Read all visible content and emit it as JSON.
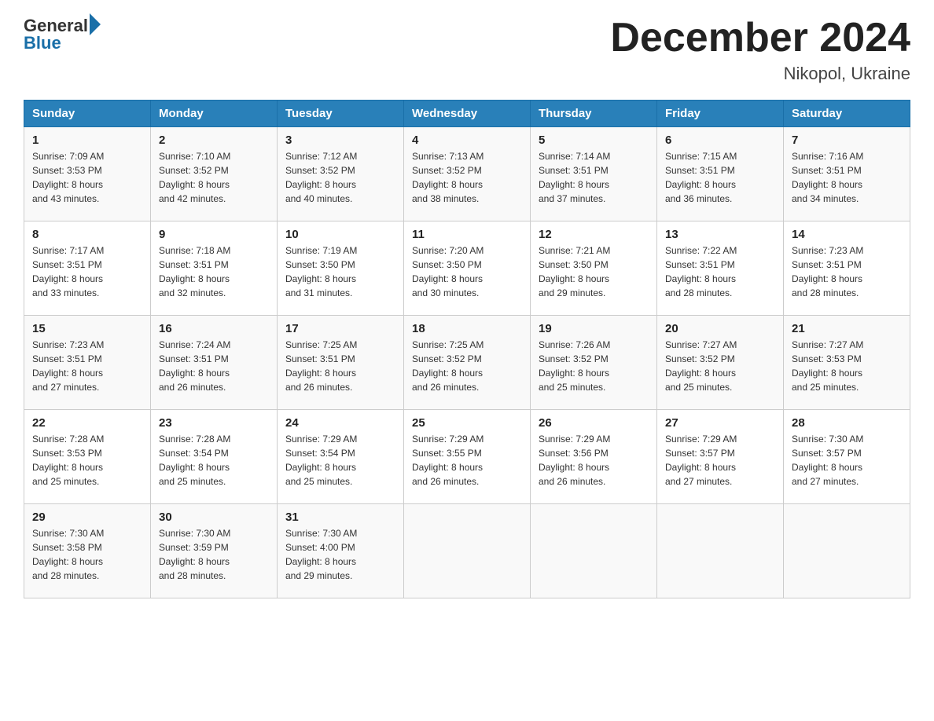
{
  "header": {
    "logo_general": "General",
    "logo_blue": "Blue",
    "month_title": "December 2024",
    "location": "Nikopol, Ukraine"
  },
  "days_of_week": [
    "Sunday",
    "Monday",
    "Tuesday",
    "Wednesday",
    "Thursday",
    "Friday",
    "Saturday"
  ],
  "weeks": [
    [
      {
        "day": "1",
        "sunrise": "7:09 AM",
        "sunset": "3:53 PM",
        "daylight": "8 hours and 43 minutes."
      },
      {
        "day": "2",
        "sunrise": "7:10 AM",
        "sunset": "3:52 PM",
        "daylight": "8 hours and 42 minutes."
      },
      {
        "day": "3",
        "sunrise": "7:12 AM",
        "sunset": "3:52 PM",
        "daylight": "8 hours and 40 minutes."
      },
      {
        "day": "4",
        "sunrise": "7:13 AM",
        "sunset": "3:52 PM",
        "daylight": "8 hours and 38 minutes."
      },
      {
        "day": "5",
        "sunrise": "7:14 AM",
        "sunset": "3:51 PM",
        "daylight": "8 hours and 37 minutes."
      },
      {
        "day": "6",
        "sunrise": "7:15 AM",
        "sunset": "3:51 PM",
        "daylight": "8 hours and 36 minutes."
      },
      {
        "day": "7",
        "sunrise": "7:16 AM",
        "sunset": "3:51 PM",
        "daylight": "8 hours and 34 minutes."
      }
    ],
    [
      {
        "day": "8",
        "sunrise": "7:17 AM",
        "sunset": "3:51 PM",
        "daylight": "8 hours and 33 minutes."
      },
      {
        "day": "9",
        "sunrise": "7:18 AM",
        "sunset": "3:51 PM",
        "daylight": "8 hours and 32 minutes."
      },
      {
        "day": "10",
        "sunrise": "7:19 AM",
        "sunset": "3:50 PM",
        "daylight": "8 hours and 31 minutes."
      },
      {
        "day": "11",
        "sunrise": "7:20 AM",
        "sunset": "3:50 PM",
        "daylight": "8 hours and 30 minutes."
      },
      {
        "day": "12",
        "sunrise": "7:21 AM",
        "sunset": "3:50 PM",
        "daylight": "8 hours and 29 minutes."
      },
      {
        "day": "13",
        "sunrise": "7:22 AM",
        "sunset": "3:51 PM",
        "daylight": "8 hours and 28 minutes."
      },
      {
        "day": "14",
        "sunrise": "7:23 AM",
        "sunset": "3:51 PM",
        "daylight": "8 hours and 28 minutes."
      }
    ],
    [
      {
        "day": "15",
        "sunrise": "7:23 AM",
        "sunset": "3:51 PM",
        "daylight": "8 hours and 27 minutes."
      },
      {
        "day": "16",
        "sunrise": "7:24 AM",
        "sunset": "3:51 PM",
        "daylight": "8 hours and 26 minutes."
      },
      {
        "day": "17",
        "sunrise": "7:25 AM",
        "sunset": "3:51 PM",
        "daylight": "8 hours and 26 minutes."
      },
      {
        "day": "18",
        "sunrise": "7:25 AM",
        "sunset": "3:52 PM",
        "daylight": "8 hours and 26 minutes."
      },
      {
        "day": "19",
        "sunrise": "7:26 AM",
        "sunset": "3:52 PM",
        "daylight": "8 hours and 25 minutes."
      },
      {
        "day": "20",
        "sunrise": "7:27 AM",
        "sunset": "3:52 PM",
        "daylight": "8 hours and 25 minutes."
      },
      {
        "day": "21",
        "sunrise": "7:27 AM",
        "sunset": "3:53 PM",
        "daylight": "8 hours and 25 minutes."
      }
    ],
    [
      {
        "day": "22",
        "sunrise": "7:28 AM",
        "sunset": "3:53 PM",
        "daylight": "8 hours and 25 minutes."
      },
      {
        "day": "23",
        "sunrise": "7:28 AM",
        "sunset": "3:54 PM",
        "daylight": "8 hours and 25 minutes."
      },
      {
        "day": "24",
        "sunrise": "7:29 AM",
        "sunset": "3:54 PM",
        "daylight": "8 hours and 25 minutes."
      },
      {
        "day": "25",
        "sunrise": "7:29 AM",
        "sunset": "3:55 PM",
        "daylight": "8 hours and 26 minutes."
      },
      {
        "day": "26",
        "sunrise": "7:29 AM",
        "sunset": "3:56 PM",
        "daylight": "8 hours and 26 minutes."
      },
      {
        "day": "27",
        "sunrise": "7:29 AM",
        "sunset": "3:57 PM",
        "daylight": "8 hours and 27 minutes."
      },
      {
        "day": "28",
        "sunrise": "7:30 AM",
        "sunset": "3:57 PM",
        "daylight": "8 hours and 27 minutes."
      }
    ],
    [
      {
        "day": "29",
        "sunrise": "7:30 AM",
        "sunset": "3:58 PM",
        "daylight": "8 hours and 28 minutes."
      },
      {
        "day": "30",
        "sunrise": "7:30 AM",
        "sunset": "3:59 PM",
        "daylight": "8 hours and 28 minutes."
      },
      {
        "day": "31",
        "sunrise": "7:30 AM",
        "sunset": "4:00 PM",
        "daylight": "8 hours and 29 minutes."
      },
      null,
      null,
      null,
      null
    ]
  ],
  "labels": {
    "sunrise": "Sunrise:",
    "sunset": "Sunset:",
    "daylight": "Daylight:"
  }
}
